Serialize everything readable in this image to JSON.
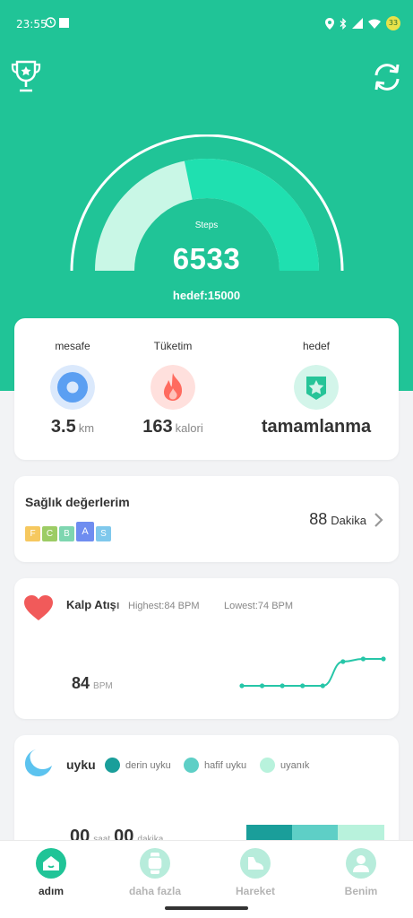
{
  "status_bar": {
    "time": "23:55",
    "battery": "33"
  },
  "header": {
    "left_icon": "trophy-icon",
    "right_icon": "sync-icon"
  },
  "steps": {
    "label": "Steps",
    "value": "6533",
    "goal_text": "hedef:15000",
    "progress": 0.4355
  },
  "stats": [
    {
      "label": "mesafe",
      "value": "3.5",
      "unit": "km",
      "icon": "location-icon",
      "color": "#4f9cf0"
    },
    {
      "label": "Tüketim",
      "value": "163",
      "unit": "kalori",
      "icon": "flame-icon",
      "color": "#ff6a5c"
    },
    {
      "label": "hedef",
      "value": "tamamlanma",
      "unit": "",
      "icon": "star-badge-icon",
      "color": "#26c498"
    }
  ],
  "health": {
    "title": "Sağlık değerlerim",
    "letters": [
      {
        "text": "F",
        "color": "#f6c85f"
      },
      {
        "text": "C",
        "color": "#9ccc65"
      },
      {
        "text": "B",
        "color": "#7ed6b0"
      },
      {
        "text": "A",
        "color": "#6f8df0"
      },
      {
        "text": "S",
        "color": "#7fc8ec"
      }
    ],
    "minutes": "88",
    "minutes_unit": "Dakika"
  },
  "heart_rate": {
    "title": "Kalp Atışı",
    "highest": "Highest:84  BPM",
    "lowest": "Lowest:74  BPM",
    "value": "84",
    "unit": "BPM",
    "trend": [
      74,
      74,
      74,
      74,
      74,
      83,
      84,
      84
    ]
  },
  "sleep": {
    "title": "uyku",
    "legend": [
      {
        "label": "derin uyku",
        "color": "#1a9e9a"
      },
      {
        "label": "hafif uyku",
        "color": "#5ecfc6"
      },
      {
        "label": "uyanık",
        "color": "#b8f2dc"
      }
    ],
    "hours": "00",
    "hours_unit": "saat",
    "minutes": "00",
    "minutes_unit": "dakika",
    "bar_fractions": [
      0.33,
      0.33,
      0.34
    ]
  },
  "nav": [
    {
      "label": "adım",
      "active": true
    },
    {
      "label": "daha fazla",
      "active": false
    },
    {
      "label": "Hareket",
      "active": false
    },
    {
      "label": "Benim",
      "active": false
    }
  ],
  "colors": {
    "primary": "#20c497",
    "gauge_bg": "#c9f7e6",
    "gauge_fill": "#1fe0b0",
    "heart": "#f15a5a",
    "heart_line": "#26c6a8"
  }
}
